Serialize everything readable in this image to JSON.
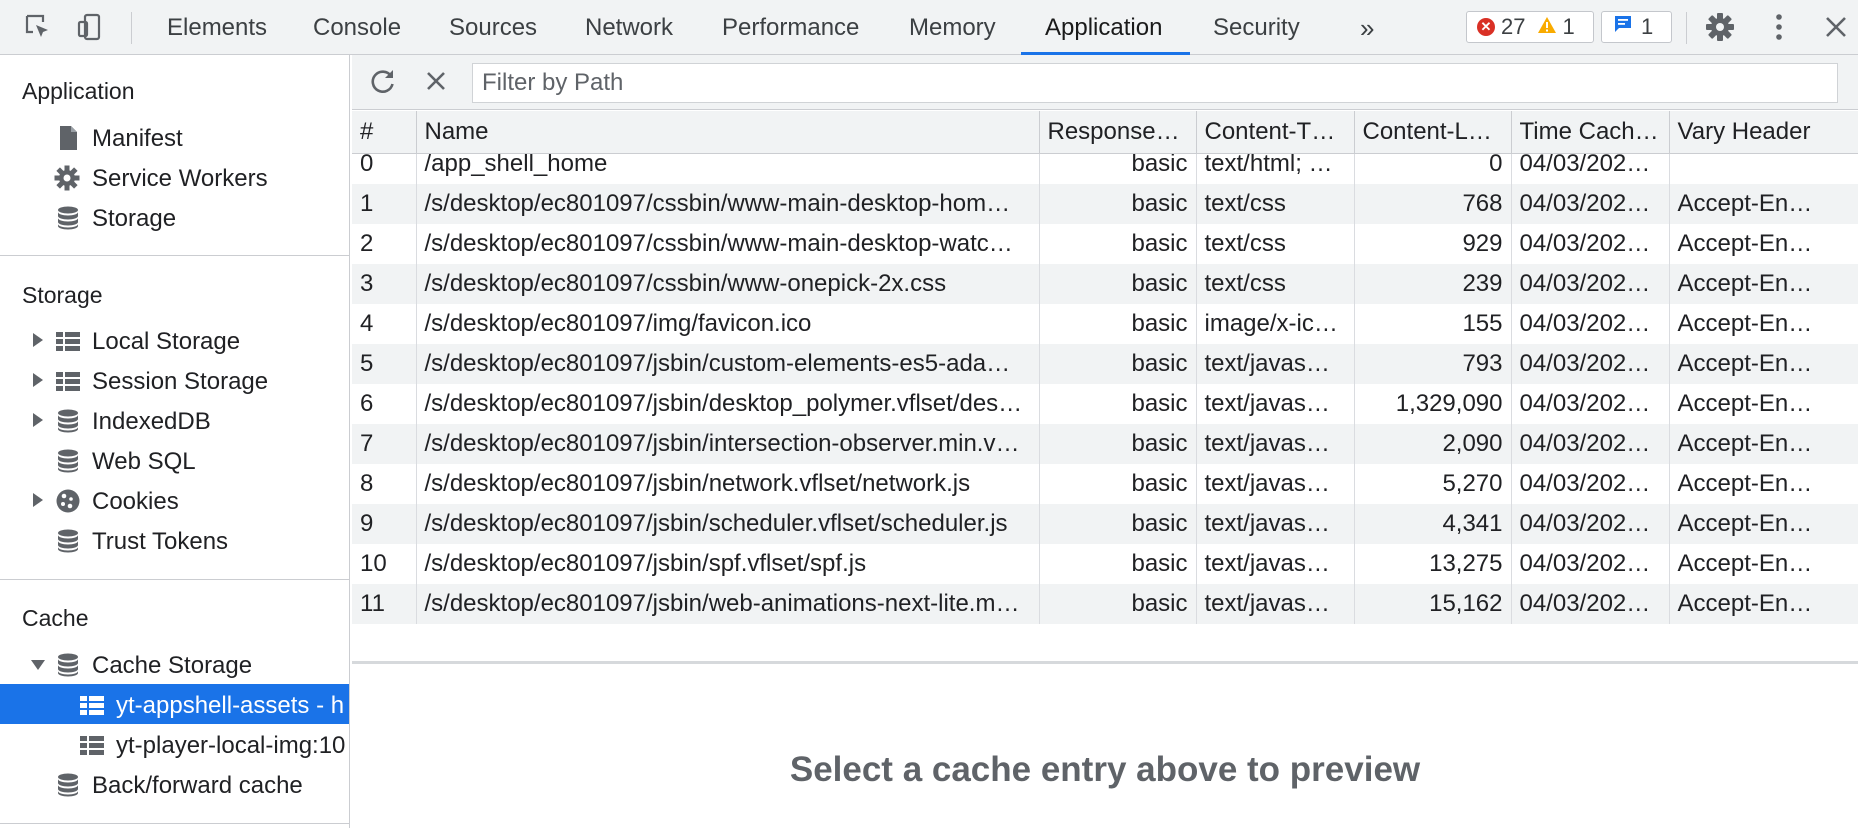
{
  "toolbar": {
    "tabs": [
      "Elements",
      "Console",
      "Sources",
      "Network",
      "Performance",
      "Memory",
      "Application",
      "Security"
    ],
    "active_tab": "Application",
    "overflow": "»",
    "errors_count": "27",
    "warnings_count": "1",
    "messages_count": "1"
  },
  "sidebar": {
    "application": {
      "title": "Application",
      "items": [
        "Manifest",
        "Service Workers",
        "Storage"
      ]
    },
    "storage": {
      "title": "Storage",
      "items": [
        "Local Storage",
        "Session Storage",
        "IndexedDB",
        "Web SQL",
        "Cookies",
        "Trust Tokens"
      ]
    },
    "cache": {
      "title": "Cache",
      "items": [
        "Cache Storage",
        "yt-appshell-assets - h",
        "yt-player-local-img:10",
        "Back/forward cache"
      ],
      "selected": "yt-appshell-assets - h"
    }
  },
  "filter": {
    "placeholder": "Filter by Path"
  },
  "table": {
    "columns": [
      "#",
      "Name",
      "Response…",
      "Content-T…",
      "Content-L…",
      "Time Cach…",
      "Vary Header"
    ],
    "rows": [
      [
        "0",
        "/app_shell_home",
        "basic",
        "text/html; …",
        "0",
        "04/03/202…",
        ""
      ],
      [
        "1",
        "/s/desktop/ec801097/cssbin/www-main-desktop-hom…",
        "basic",
        "text/css",
        "768",
        "04/03/202…",
        "Accept-En…"
      ],
      [
        "2",
        "/s/desktop/ec801097/cssbin/www-main-desktop-watc…",
        "basic",
        "text/css",
        "929",
        "04/03/202…",
        "Accept-En…"
      ],
      [
        "3",
        "/s/desktop/ec801097/cssbin/www-onepick-2x.css",
        "basic",
        "text/css",
        "239",
        "04/03/202…",
        "Accept-En…"
      ],
      [
        "4",
        "/s/desktop/ec801097/img/favicon.ico",
        "basic",
        "image/x-ic…",
        "155",
        "04/03/202…",
        "Accept-En…"
      ],
      [
        "5",
        "/s/desktop/ec801097/jsbin/custom-elements-es5-ada…",
        "basic",
        "text/javas…",
        "793",
        "04/03/202…",
        "Accept-En…"
      ],
      [
        "6",
        "/s/desktop/ec801097/jsbin/desktop_polymer.vflset/des…",
        "basic",
        "text/javas…",
        "1,329,090",
        "04/03/202…",
        "Accept-En…"
      ],
      [
        "7",
        "/s/desktop/ec801097/jsbin/intersection-observer.min.v…",
        "basic",
        "text/javas…",
        "2,090",
        "04/03/202…",
        "Accept-En…"
      ],
      [
        "8",
        "/s/desktop/ec801097/jsbin/network.vflset/network.js",
        "basic",
        "text/javas…",
        "5,270",
        "04/03/202…",
        "Accept-En…"
      ],
      [
        "9",
        "/s/desktop/ec801097/jsbin/scheduler.vflset/scheduler.js",
        "basic",
        "text/javas…",
        "4,341",
        "04/03/202…",
        "Accept-En…"
      ],
      [
        "10",
        "/s/desktop/ec801097/jsbin/spf.vflset/spf.js",
        "basic",
        "text/javas…",
        "13,275",
        "04/03/202…",
        "Accept-En…"
      ],
      [
        "11",
        "/s/desktop/ec801097/jsbin/web-animations-next-lite.m…",
        "basic",
        "text/javas…",
        "15,162",
        "04/03/202…",
        "Accept-En…"
      ]
    ]
  },
  "preview": {
    "text": "Select a cache entry above to preview"
  },
  "colors": {
    "accent": "#1a73e8",
    "error": "#d93025",
    "warning": "#f9ab00"
  }
}
